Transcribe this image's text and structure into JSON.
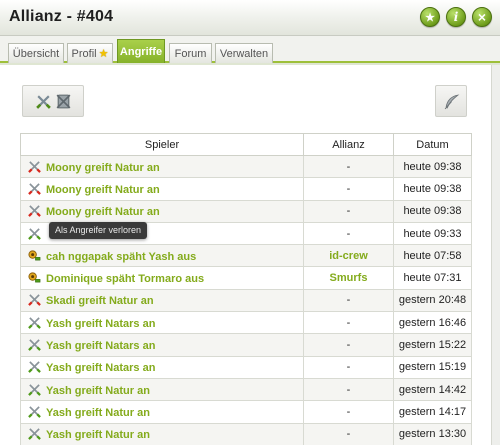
{
  "window": {
    "title": "Allianz - #404",
    "buttons": [
      {
        "name": "favorite-star-icon",
        "glyph": "★"
      },
      {
        "name": "info-icon",
        "glyph": "i"
      },
      {
        "name": "close-icon",
        "glyph": "×"
      }
    ]
  },
  "tabs": [
    {
      "label": "Übersicht",
      "active": false
    },
    {
      "label": "Profil",
      "active": false,
      "badge": "star-icon"
    },
    {
      "label": "Angriffe",
      "active": true
    },
    {
      "label": "Forum",
      "active": false
    },
    {
      "label": "Verwalten",
      "active": false
    }
  ],
  "toolbar": {
    "left_icons": [
      "attack-won-filter-icon",
      "attack-lost-filter-icon"
    ],
    "right_icon": "feather-icon"
  },
  "table": {
    "headers": {
      "player": "Spieler",
      "alliance": "Allianz",
      "date": "Datum"
    },
    "rows": [
      {
        "icon": "attack-lost",
        "text": "Moony greift Natur an",
        "alliance": "-",
        "date": "heute 09:38"
      },
      {
        "icon": "attack-lost",
        "text": "Moony greift Natur an",
        "alliance": "-",
        "date": "heute 09:38"
      },
      {
        "icon": "attack-lost",
        "text": "Moony greift Natur an",
        "alliance": "-",
        "date": "heute 09:38"
      },
      {
        "icon": "attack-won",
        "text": "",
        "alliance": "-",
        "date": "heute 09:33"
      },
      {
        "icon": "spy",
        "text": "cah nggapak späht Yash aus",
        "alliance": "id-crew",
        "date": "heute 07:58"
      },
      {
        "icon": "spy",
        "text": "Dominique späht Tormaro aus",
        "alliance": "Smurfs",
        "date": "heute 07:31"
      },
      {
        "icon": "attack-lost",
        "text": "Skadi greift Natur an",
        "alliance": "-",
        "date": "gestern 20:48"
      },
      {
        "icon": "attack-won",
        "text": "Yash greift Natars an",
        "alliance": "-",
        "date": "gestern 16:46"
      },
      {
        "icon": "attack-won",
        "text": "Yash greift Natars an",
        "alliance": "-",
        "date": "gestern 15:22"
      },
      {
        "icon": "attack-won",
        "text": "Yash greift Natars an",
        "alliance": "-",
        "date": "gestern 15:19"
      },
      {
        "icon": "attack-won",
        "text": "Yash greift Natur an",
        "alliance": "-",
        "date": "gestern 14:42"
      },
      {
        "icon": "attack-won",
        "text": "Yash greift Natur an",
        "alliance": "-",
        "date": "gestern 14:17"
      },
      {
        "icon": "attack-won",
        "text": "Yash greift Natur an",
        "alliance": "-",
        "date": "gestern 13:30"
      }
    ]
  },
  "tooltip": {
    "text": "Als Angreifer verloren"
  },
  "colors": {
    "accent_green": "#84ab1c",
    "tab_active": "#9ec03a",
    "tooltip_bg": "#3a3a3a"
  }
}
